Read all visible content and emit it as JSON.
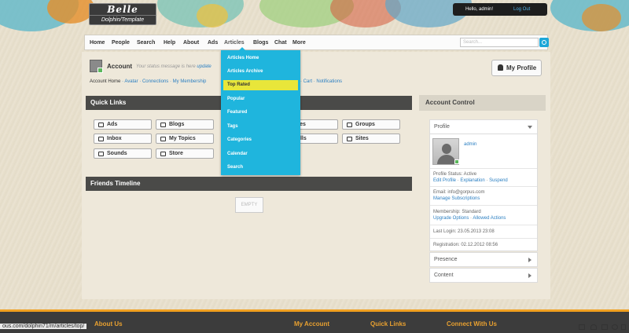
{
  "logo": {
    "line1": "Belle",
    "line2": "Dolphin/Template"
  },
  "userbar": {
    "greeting": "Hello, admin!",
    "logout": "Log Out"
  },
  "nav": {
    "items": [
      "Home",
      "People",
      "Search",
      "Help",
      "About",
      "Ads",
      "Articles",
      "Blogs",
      "Chat",
      "More"
    ],
    "active": "Articles",
    "search_placeholder": "Search..."
  },
  "account": {
    "title": "Account",
    "status_prefix": "Your status message is here",
    "status_link": "update",
    "my_profile": "My Profile",
    "submenu_home": "Account Home",
    "submenu_links": [
      "Avatar",
      "Connections",
      "My Membership"
    ],
    "submenu_links_right": [
      "Cart",
      "Notifications"
    ]
  },
  "quick_links": {
    "title": "Quick Links",
    "buttons": [
      {
        "label": "Ads",
        "icon": "ads-icon"
      },
      {
        "label": "Blogs",
        "icon": "book-icon"
      },
      {
        "label": "Files",
        "icon": "files-icon"
      },
      {
        "label": "Groups",
        "icon": "groups-icon"
      },
      {
        "label": "Inbox",
        "icon": "mail-icon"
      },
      {
        "label": "My Topics",
        "icon": "comments-icon"
      },
      {
        "label": "Polls",
        "icon": "polls-icon"
      },
      {
        "label": "Sites",
        "icon": "link-icon"
      },
      {
        "label": "Sounds",
        "icon": "music-icon"
      },
      {
        "label": "Store",
        "icon": "store-icon"
      }
    ]
  },
  "friends_timeline": {
    "title": "Friends Timeline",
    "empty": "EMPTY"
  },
  "account_control": {
    "title": "Account Control",
    "profile": "Profile",
    "username": "admin",
    "status_label": "Profile Status: Active",
    "status_links": [
      "Edit Profile",
      "Explanation",
      "Suspend"
    ],
    "email": "Email: info@gorpus.com",
    "manage": "Manage Subscriptions",
    "membership": "Membership: Standard",
    "membership_links": [
      "Upgrade Options",
      "Allowed Actions"
    ],
    "last_login": "Last Login: 23.05.2013 23:08",
    "registration": "Registration: 02.12.2012 08:56",
    "presence": "Presence",
    "content": "Content"
  },
  "articles_menu": {
    "items": [
      "Articles Home",
      "Articles Archive",
      "Top Rated",
      "Popular",
      "Featured",
      "Tags",
      "Categories",
      "Calendar",
      "Search"
    ],
    "highlighted": "Top Rated"
  },
  "footer": {
    "about": "About Us",
    "my_account": "My Account",
    "quick_links": "Quick Links",
    "connect": "Connect With Us"
  },
  "statusbar": {
    "url": "ous.com/dolphin71/m/articles/top/"
  },
  "colors": {
    "accent": "#1fb5dd",
    "highlight": "#e8e63a",
    "footer_accent": "#f0a020",
    "link": "#2b7fc2"
  }
}
